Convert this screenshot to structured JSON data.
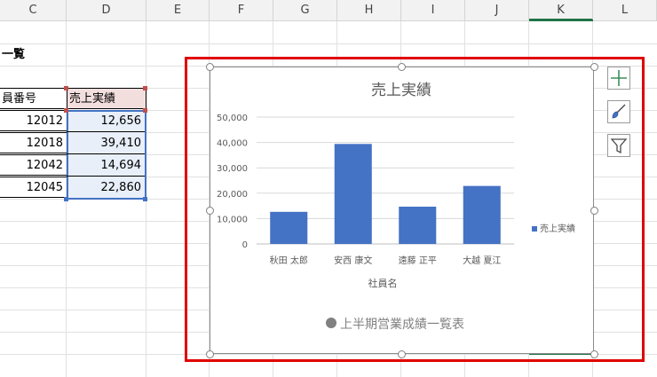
{
  "columns": [
    "C",
    "D",
    "E",
    "F",
    "G",
    "H",
    "I",
    "J",
    "K",
    "L"
  ],
  "sheet": {
    "title_fragment": "一覧",
    "header_c": "員番号",
    "header_d": "売上実績",
    "rows": [
      {
        "id": "12012",
        "sales": "12,656"
      },
      {
        "id": "12018",
        "sales": "39,410"
      },
      {
        "id": "12042",
        "sales": "14,694"
      },
      {
        "id": "12045",
        "sales": "22,860"
      }
    ]
  },
  "chart_data": {
    "type": "bar",
    "title": "売上実績",
    "categories": [
      "秋田 太郎",
      "安西 康文",
      "遠藤 正平",
      "大越 夏江"
    ],
    "series": [
      {
        "name": "売上実績",
        "values": [
          12656,
          39410,
          14694,
          22860
        ],
        "color": "#4472c4"
      }
    ],
    "xlabel": "社員名",
    "ylabel": "",
    "ylim": [
      0,
      50000
    ],
    "yticks": [
      "0",
      "10,000",
      "20,000",
      "30,000",
      "40,000",
      "50,000"
    ],
    "grid": true,
    "legend": "right",
    "footnote": "上半期営業成績一覧表"
  },
  "colors": {
    "bar": "#4472c4",
    "annotation": "#e00000",
    "excel_green": "#217346"
  },
  "icons": [
    "add-element-icon",
    "brush-icon",
    "filter-icon"
  ]
}
